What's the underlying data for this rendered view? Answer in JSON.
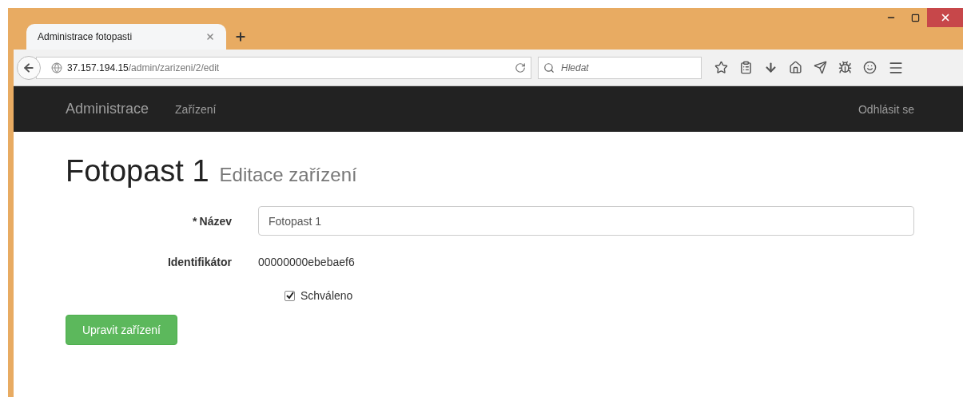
{
  "browser": {
    "tab": {
      "title": "Administrace fotopasti"
    },
    "url": {
      "host": "37.157.194.15",
      "path": "/admin/zarizeni/2/edit"
    },
    "search": {
      "placeholder": "Hledat"
    }
  },
  "navbar": {
    "brand": "Administrace",
    "links": [
      {
        "label": "Zařízení"
      }
    ],
    "logout": "Odhlásit se"
  },
  "heading": {
    "title": "Fotopast 1",
    "subtitle": "Editace zařízení"
  },
  "form": {
    "name": {
      "required_mark": "*",
      "label": "Název",
      "value": "Fotopast 1"
    },
    "identifier": {
      "label": "Identifikátor",
      "value": "00000000ebebaef6"
    },
    "approved": {
      "label": "Schváleno",
      "checked": true
    },
    "submit": "Upravit zařízení"
  }
}
